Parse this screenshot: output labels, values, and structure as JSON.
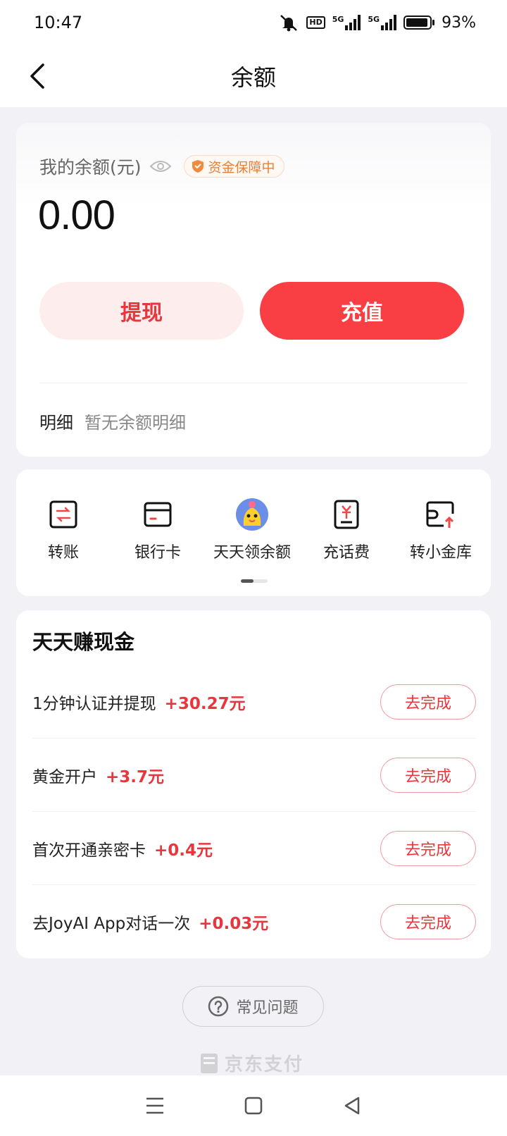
{
  "status_bar": {
    "time": "10:47",
    "battery": "93%",
    "battery_level": 0.93,
    "network_1": "5G",
    "network_2": "5G",
    "hd_label": "HD"
  },
  "header": {
    "title": "余额"
  },
  "balance": {
    "label": "我的余额(元)",
    "guarantee": "资金保障中",
    "value": "0.00",
    "withdraw_label": "提现",
    "recharge_label": "充值",
    "detail_title": "明细",
    "detail_empty": "暂无余额明细"
  },
  "tools": [
    {
      "label": "转账",
      "icon": "transfer-icon"
    },
    {
      "label": "银行卡",
      "icon": "bank-card-icon"
    },
    {
      "label": "天天领余额",
      "icon": "mascot-icon"
    },
    {
      "label": "充话费",
      "icon": "phone-bill-icon"
    },
    {
      "label": "转小金库",
      "icon": "vault-transfer-icon"
    }
  ],
  "tasks": {
    "title": "天天赚现金",
    "items": [
      {
        "text": "1分钟认证并提现",
        "reward": "+30.27元",
        "button": "去完成"
      },
      {
        "text": "黄金开户",
        "reward": "+3.7元",
        "button": "去完成"
      },
      {
        "text": "首次开通亲密卡",
        "reward": "+0.4元",
        "button": "去完成"
      },
      {
        "text": "去JoyAI App对话一次",
        "reward": "+0.03元",
        "button": "去完成"
      }
    ]
  },
  "faq": {
    "label": "常见问题"
  },
  "footer": {
    "brand": "京东支付"
  },
  "colors": {
    "accent": "#fa3f44",
    "accent_light": "#fdeeed",
    "guarantee": "#e5813a",
    "background": "#f2f2f6"
  }
}
